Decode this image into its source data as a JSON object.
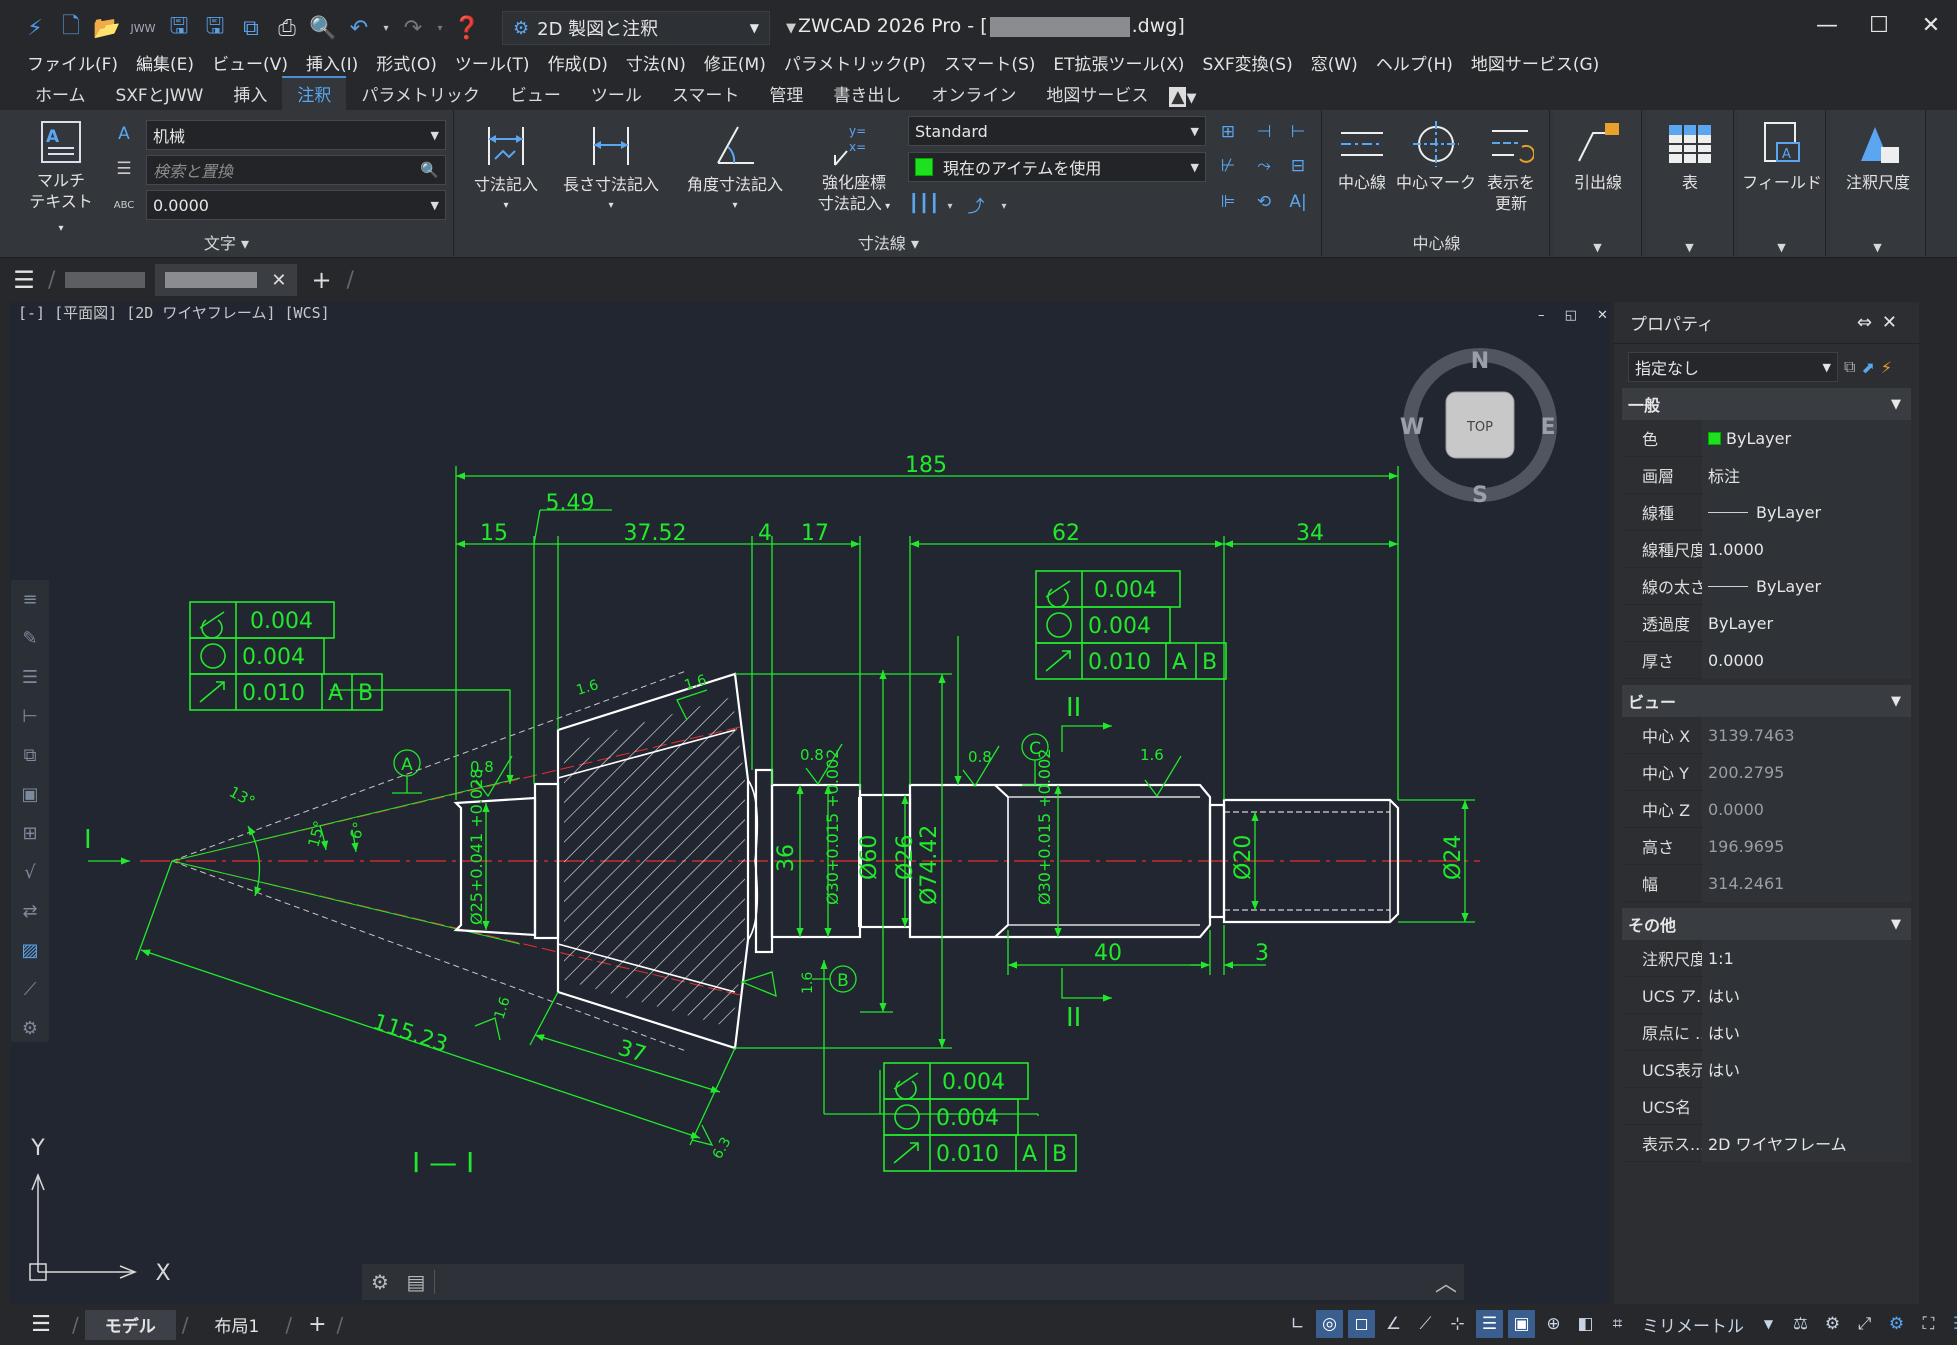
{
  "window": {
    "workspace": "2D 製図と注釈",
    "title_prefix": "ZWCAD 2026 Pro - [",
    "title_suffix": ".dwg]",
    "min": "—",
    "max": "☐",
    "close": "✕"
  },
  "menu": [
    "ファイル(F)",
    "編集(E)",
    "ビュー(V)",
    "挿入(I)",
    "形式(O)",
    "ツール(T)",
    "作成(D)",
    "寸法(N)",
    "修正(M)",
    "パラメトリック(P)",
    "スマート(S)",
    "ET拡張ツール(X)",
    "SXF変換(S)",
    "窓(W)",
    "ヘルプ(H)",
    "地図サービス(G)"
  ],
  "ribbon_tabs": [
    "ホーム",
    "SXFとJWW",
    "挿入",
    "注釈",
    "パラメトリック",
    "ビュー",
    "ツール",
    "スマート",
    "管理",
    "書き出し",
    "オンライン",
    "地図サービス"
  ],
  "ribbon_active_tab": "注釈",
  "text_panel": {
    "label": "文字",
    "mtext_l1": "マルチ",
    "mtext_l2": "テキスト",
    "style": "机械",
    "find_placeholder": "検索と置換",
    "height": "0.0000"
  },
  "dim_panel": {
    "label": "寸法線",
    "linear": "寸法記入",
    "length": "長さ寸法記入",
    "angular": "角度寸法記入",
    "ord_l1": "強化座標",
    "ord_l2": "寸法記入",
    "dimstyle": "Standard",
    "layer": "現在のアイテムを使用"
  },
  "center_panel": {
    "label": "中心線",
    "centerline": "中心線",
    "centermark": "中心マーク",
    "update_l1": "表示を",
    "update_l2": "更新"
  },
  "other_buttons": {
    "leader": "引出線",
    "table": "表",
    "field": "フィールド",
    "scale": "注釈尺度"
  },
  "viewport_label": "[-] [平面図] [2D ワイヤフレーム] [WCS]",
  "viewcube": {
    "n": "N",
    "s": "S",
    "e": "E",
    "w": "W",
    "top": "TOP"
  },
  "ucs": {
    "x": "X",
    "y": "Y"
  },
  "drawing": {
    "dims": [
      "185",
      "5.49",
      "15",
      "37.52",
      "4",
      "17",
      "62",
      "34",
      "40",
      "3",
      "115.23",
      "37"
    ],
    "diameters": [
      "Ø25+0.041 +0.028",
      "36",
      "Ø30+0.015 +0.002",
      "Ø60",
      "Ø26",
      "Ø74.42",
      "Ø30+0.015 +0.002",
      "Ø20",
      "Ø24"
    ],
    "fcf_values": [
      "0.004",
      "0.004",
      "0.010"
    ],
    "datums": [
      "A",
      "B",
      "C"
    ],
    "datum_ref": [
      "A",
      "B"
    ],
    "roughness": [
      "1.6",
      "1.6",
      "0.8",
      "0.8",
      "0.8",
      "1.6",
      "1.6",
      "1.6",
      "6.3"
    ],
    "angles": [
      "13°",
      "15°",
      "6°"
    ],
    "section_marks": [
      "I",
      "II",
      "II"
    ],
    "section_title": "I — I"
  },
  "properties": {
    "title": "プロパティ",
    "selection": "指定なし",
    "sections": [
      {
        "name": "一般",
        "rows": [
          {
            "k": "色",
            "v": "ByLayer"
          },
          {
            "k": "画層",
            "v": "标注"
          },
          {
            "k": "線種",
            "v": "ByLayer"
          },
          {
            "k": "線種尺度",
            "v": "1.0000"
          },
          {
            "k": "線の太さ",
            "v": "ByLayer"
          },
          {
            "k": "透過度",
            "v": "ByLayer"
          },
          {
            "k": "厚さ",
            "v": "0.0000"
          }
        ]
      },
      {
        "name": "ビュー",
        "rows": [
          {
            "k": "中心 X",
            "v": "3139.7463"
          },
          {
            "k": "中心 Y",
            "v": "200.2795"
          },
          {
            "k": "中心 Z",
            "v": "0.0000"
          },
          {
            "k": "高さ",
            "v": "196.9695"
          },
          {
            "k": "幅",
            "v": "314.2461"
          }
        ]
      },
      {
        "name": "その他",
        "rows": [
          {
            "k": "注釈尺度",
            "v": "1:1"
          },
          {
            "k": "UCS ア...",
            "v": "はい"
          },
          {
            "k": "原点に ...",
            "v": "はい"
          },
          {
            "k": "UCS表示",
            "v": "はい"
          },
          {
            "k": "UCS名",
            "v": ""
          },
          {
            "k": "表示ス...",
            "v": "2D ワイヤフレーム"
          }
        ]
      }
    ]
  },
  "layout_tabs": [
    "モデル",
    "布局1"
  ],
  "units": "ミリメートル",
  "colors": {
    "dim_green": "#22e82c",
    "outline": "#ffffff",
    "center_red": "#e83030",
    "accent": "#4a8fd6"
  }
}
